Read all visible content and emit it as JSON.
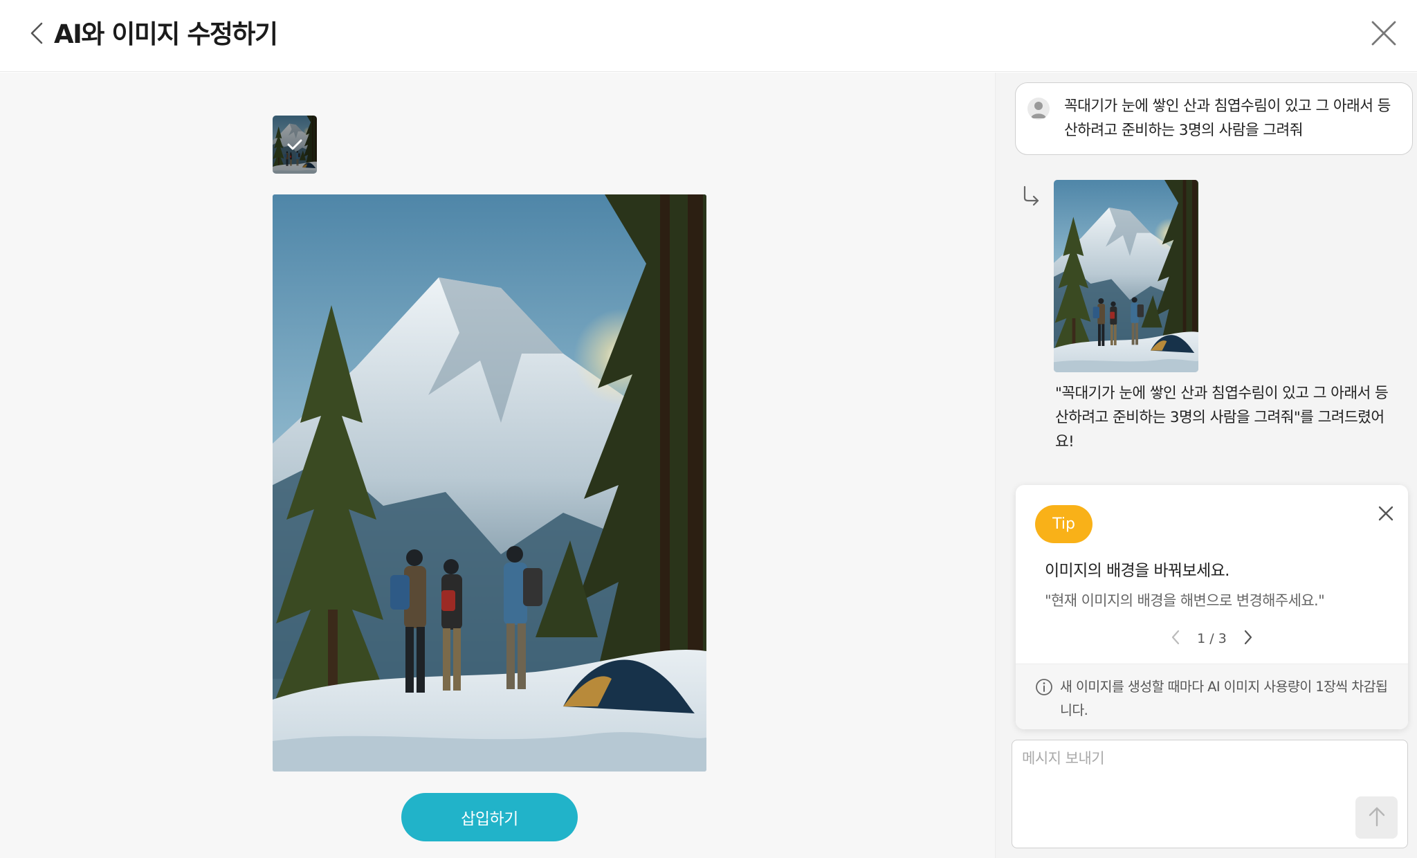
{
  "header": {
    "title": "AI와 이미지 수정하기",
    "back_icon": "chevron-left-icon",
    "close_icon": "close-icon"
  },
  "editor": {
    "selected_thumbnail_check_icon": "check-icon",
    "insert_button_label": "삽입하기"
  },
  "chat": {
    "user_message": "꼭대기가 눈에 쌓인 산과 침엽수림이 있고 그 아래서 등산하려고 준비하는 3명의 사람을 그려줘",
    "user_avatar_icon": "user-avatar-icon",
    "reply_icon": "reply-arrow-icon",
    "ai_response": "\"꼭대기가 눈에 쌓인 산과 침엽수림이 있고 그 아래서 등산하려고 준비하는 3명의 사람을 그려줘\"를 그려드렸어요!"
  },
  "tip": {
    "badge": "Tip",
    "heading": "이미지의 배경을 바꿔보세요.",
    "example": "\"현재 이미지의 배경을 해변으로 변경해주세요.\"",
    "pager": "1 / 3",
    "footer": "새 이미지를 생성할 때마다 AI 이미지 사용량이 1장씩 차감됩니다.",
    "info_icon": "info-icon"
  },
  "composer": {
    "placeholder": "메시지 보내기",
    "value": "",
    "send_icon": "arrow-up-icon"
  },
  "colors": {
    "accent": "#21b3c9",
    "tip_badge": "#f9b118",
    "panel_bg": "#f4f4f4",
    "canvas_bg": "#f7f7f7"
  }
}
